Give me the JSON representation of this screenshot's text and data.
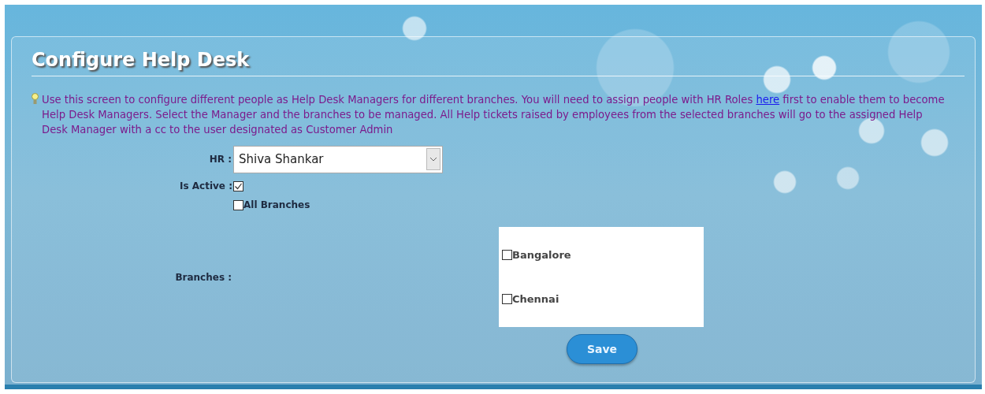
{
  "title": "Configure Help Desk",
  "intro": {
    "before": "Use this screen to configure different people as Help Desk Managers for different branches. You will need to assign people with HR Roles",
    "link": "here",
    "after": "first to enable them to become Help Desk Managers. Select the Manager and the branches to be managed. All Help tickets raised by employees from the selected branches will go to the assigned Help Desk Manager with a cc to the user designated as Customer Admin"
  },
  "hr": {
    "label": "HR :",
    "value": "Shiva Shankar"
  },
  "is_active": {
    "label": "Is Active :",
    "checked": true
  },
  "all_branches": {
    "label": "All Branches",
    "checked": false
  },
  "branches": {
    "label": "Branches :",
    "items": [
      {
        "label": "Bangalore",
        "checked": false
      },
      {
        "label": "Chennai",
        "checked": false
      }
    ]
  },
  "save_button": "Save"
}
